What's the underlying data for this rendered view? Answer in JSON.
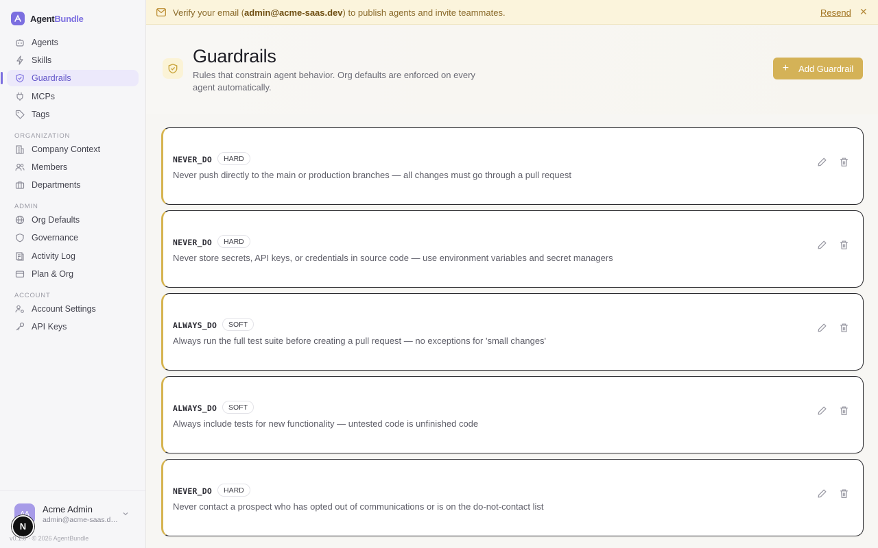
{
  "brand": {
    "name_main": "Agent",
    "name_accent": "Bundle"
  },
  "sidebar": {
    "primary": [
      {
        "label": "Agents",
        "icon": "robot-icon"
      },
      {
        "label": "Skills",
        "icon": "lightning-icon"
      },
      {
        "label": "Guardrails",
        "icon": "shield-icon",
        "active": true
      },
      {
        "label": "MCPs",
        "icon": "plug-icon"
      },
      {
        "label": "Tags",
        "icon": "tag-icon"
      }
    ],
    "org_section": "ORGANIZATION",
    "org": [
      {
        "label": "Company Context",
        "icon": "building-icon"
      },
      {
        "label": "Members",
        "icon": "users-icon"
      },
      {
        "label": "Departments",
        "icon": "briefcase-icon"
      }
    ],
    "admin_section": "ADMIN",
    "admin": [
      {
        "label": "Org Defaults",
        "icon": "globe-icon"
      },
      {
        "label": "Governance",
        "icon": "shield-outline-icon"
      },
      {
        "label": "Activity Log",
        "icon": "log-icon"
      },
      {
        "label": "Plan & Org",
        "icon": "card-icon"
      }
    ],
    "account_section": "ACCOUNT",
    "account": [
      {
        "label": "Account Settings",
        "icon": "user-cog-icon"
      },
      {
        "label": "API Keys",
        "icon": "key-icon"
      }
    ]
  },
  "user": {
    "initials": "AA",
    "name": "Acme Admin",
    "email": "admin@acme-saas.dev",
    "badge": "N",
    "version": "v0.1.0 · © 2026 AgentBundle"
  },
  "banner": {
    "prefix": "Verify your email (",
    "email": "admin@acme-saas.dev",
    "suffix": ") to publish agents and invite teammates.",
    "resend": "Resend",
    "close": "✕"
  },
  "header": {
    "title": "Guardrails",
    "description": "Rules that constrain agent behavior. Org defaults are enforced on every agent automatically.",
    "add_button": "Add Guardrail",
    "add_plus": "+"
  },
  "guardrails": [
    {
      "kind": "NEVER_DO",
      "severity": "HARD",
      "rule": "Never push directly to the main or production branches — all changes must go through a pull request"
    },
    {
      "kind": "NEVER_DO",
      "severity": "HARD",
      "rule": "Never store secrets, API keys, or credentials in source code — use environment variables and secret managers"
    },
    {
      "kind": "ALWAYS_DO",
      "severity": "SOFT",
      "rule": "Always run the full test suite before creating a pull request — no exceptions for 'small changes'"
    },
    {
      "kind": "ALWAYS_DO",
      "severity": "SOFT",
      "rule": "Always include tests for new functionality — untested code is unfinished code"
    },
    {
      "kind": "NEVER_DO",
      "severity": "HARD",
      "rule": "Never contact a prospect who has opted out of communications or is on the do-not-contact list"
    }
  ]
}
